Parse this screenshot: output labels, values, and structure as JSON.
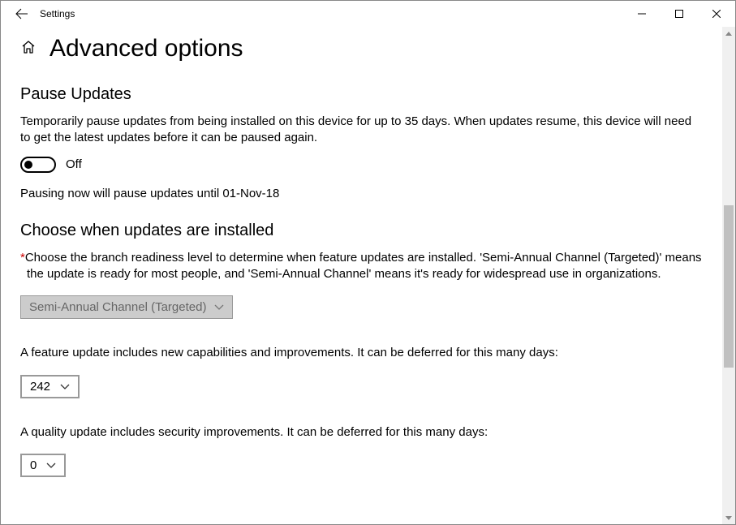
{
  "window": {
    "app_title": "Settings",
    "minimize": "",
    "maximize": "",
    "close": ""
  },
  "header": {
    "page_title": "Advanced options"
  },
  "pause": {
    "heading": "Pause Updates",
    "description": "Temporarily pause updates from being installed on this device for up to 35 days. When updates resume, this device will need to get the latest updates before it can be paused again.",
    "toggle_state": "Off",
    "until_text": "Pausing now will pause updates until 01-Nov-18"
  },
  "choose": {
    "heading": "Choose when updates are installed",
    "branch_description": "Choose the branch readiness level to determine when feature updates are installed. 'Semi-Annual Channel (Targeted)' means the update is ready for most people, and 'Semi-Annual Channel' means it's ready for widespread use in organizations.",
    "branch_value": "Semi-Annual Channel (Targeted)",
    "feature_text": "A feature update includes new capabilities and improvements. It can be deferred for this many days:",
    "feature_days": "242",
    "quality_text": "A quality update includes security improvements. It can be deferred for this many days:",
    "quality_days": "0"
  }
}
